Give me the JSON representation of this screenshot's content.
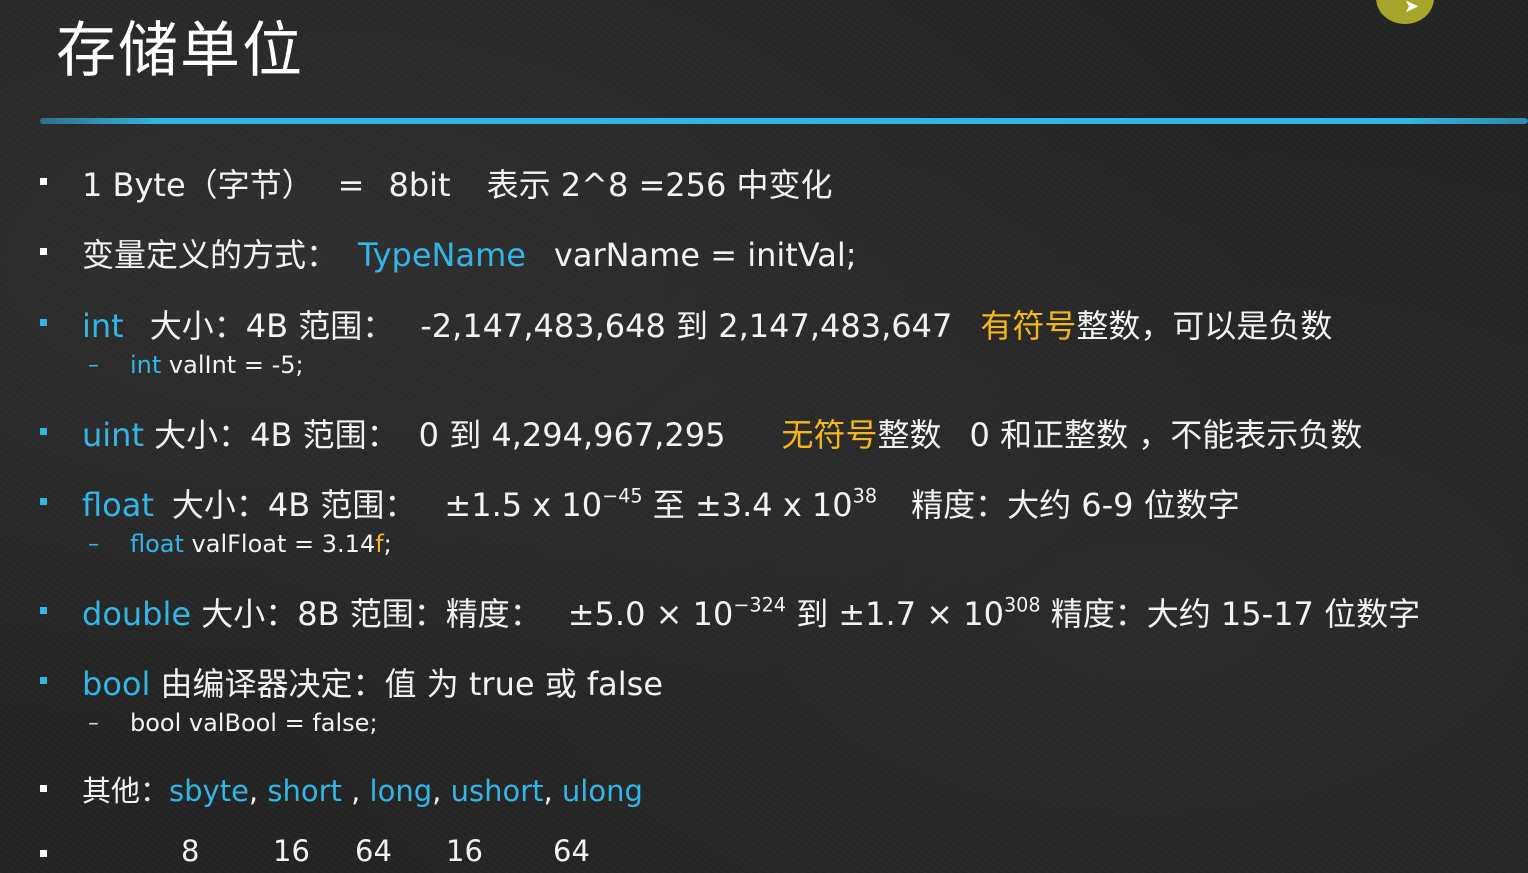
{
  "slide": {
    "title": "存储单位"
  },
  "rows": {
    "byte": {
      "text1": "1 Byte（字节）",
      "text2": "=",
      "text3": "8bit",
      "text4": "表示 2^8 =256 中变化"
    },
    "vardef": {
      "prefix": "变量定义的方式：",
      "type_name": "TypeName",
      "rest": "varName = initVal;"
    },
    "int": {
      "kw": "int",
      "size": "大小：4B 范围：",
      "range": "-2,147,483,648 到 2,147,483,647",
      "highlight": "有符号",
      "desc": "整数，可以是负数",
      "example_kw": "int",
      "example_rest": " valInt = -5;"
    },
    "uint": {
      "kw": "uint",
      "size": " 大小：4B 范围：",
      "range": "0 到 4,294,967,295",
      "highlight": "无符号",
      "desc": "整数",
      "desc2": "0 和正整数 ，不能表示负数"
    },
    "float": {
      "kw": "float",
      "size": "大小：4B 范围：",
      "range_a": "±1.5 x 10",
      "exp_a": "−45",
      "mid": " 至 ±3.4 x 10",
      "exp_b": "38",
      "precision": "精度：大约 6-9 位数字",
      "example_kw": "float",
      "example_mid": " valFloat = 3.14",
      "example_suffix": "f",
      "example_end": ";"
    },
    "double": {
      "kw": "double",
      "size": " 大小：8B 范围：精度：",
      "range_a": "±5.0 × 10",
      "exp_a": "−324",
      "mid": " 到 ±1.7 × 10",
      "exp_b": "308",
      "precision": " 精度：大约 15-17 位数字"
    },
    "bool": {
      "kw": "bool",
      "desc": " 由编译器决定：值 为 true 或 false",
      "example": "bool valBool = false;"
    },
    "other": {
      "prefix": "其他：",
      "t1": "sbyte",
      "s1": ", ",
      "t2": "short",
      "s2": " , ",
      "t3": "long",
      "s3": ",  ",
      "t4": "ushort",
      "s4": ", ",
      "t5": "ulong"
    },
    "sizes": [
      "8",
      "16",
      "64",
      "16",
      "64"
    ]
  },
  "colors": {
    "keyword": "#33b5e5",
    "highlight": "#f5b81c",
    "divider": "#33b5e5",
    "cursor": "#a6a62a"
  },
  "icons": {
    "cursor": "mouse-cursor-icon"
  }
}
